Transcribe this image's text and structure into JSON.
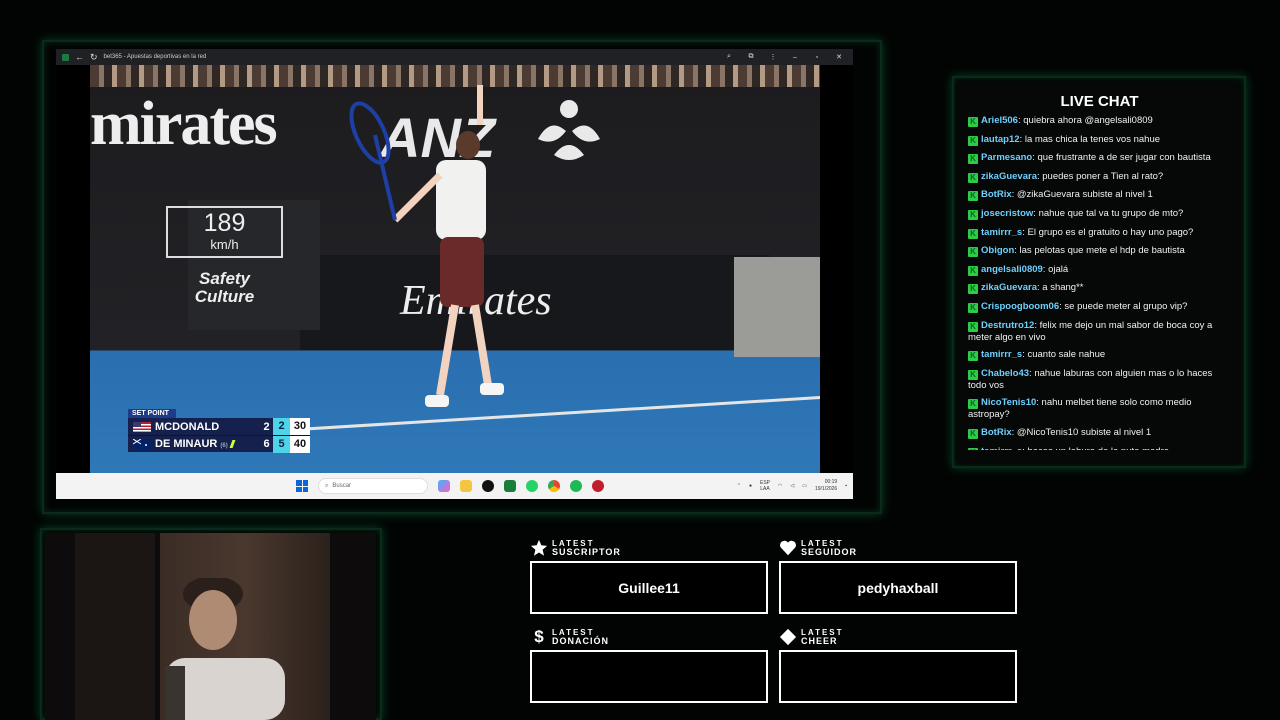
{
  "browser": {
    "tab_title": "bet365 - Apuestas deportivas en la red"
  },
  "video": {
    "speed": {
      "value": "189",
      "unit": "km/h"
    },
    "sponsors": {
      "emirates_big": "mirates",
      "anz": "ANZ",
      "safety": "Safety Culture",
      "emirates_small": "Emirates"
    },
    "scoreboard": {
      "tag": "SET POINT",
      "players": [
        {
          "name": "MCDONALD",
          "seed": "",
          "sets": "2",
          "games": "2",
          "points": "30"
        },
        {
          "name": "DE MINAUR",
          "seed": "(6)",
          "sets": "6",
          "games": "5",
          "points": "40"
        }
      ]
    }
  },
  "taskbar": {
    "search_placeholder": "Buscar",
    "lang": "ESP\nLAA",
    "time": "00:19",
    "date": "19/1/2026"
  },
  "chat": {
    "title": "LIVE CHAT",
    "messages": [
      {
        "user": "Ariel506",
        "text": "quiebra ahora @angelsali0809"
      },
      {
        "user": "lautap12",
        "text": "la mas chica la tenes vos nahue"
      },
      {
        "user": "Parmesano",
        "text": "que frustrante a de ser jugar con bautista"
      },
      {
        "user": "zikaGuevara",
        "text": "puedes poner a Tien al rato?"
      },
      {
        "user": "BotRix",
        "text": "@zikaGuevara subiste al nivel 1"
      },
      {
        "user": "josecristow",
        "text": "nahue que tal va tu grupo de mto?"
      },
      {
        "user": "tamirrr_s",
        "text": "El grupo es el gratuito o hay uno pago?"
      },
      {
        "user": "Obigon",
        "text": "las pelotas que mete el hdp de bautista"
      },
      {
        "user": "angelsali0809",
        "text": "ojalá"
      },
      {
        "user": "zikaGuevara",
        "text": "a shang**"
      },
      {
        "user": "Crispoogboom06",
        "text": "se puede meter al grupo vip?"
      },
      {
        "user": "Destrutro12",
        "text": "felix me dejo un mal sabor de boca coy a meter algo en vivo"
      },
      {
        "user": "tamirrr_s",
        "text": "cuanto sale nahue"
      },
      {
        "user": "Chabelo43",
        "text": "nahue laburas con alguien mas o lo haces todo vos"
      },
      {
        "user": "NicoTenis10",
        "text": "nahu melbet tiene solo como medio astropay?"
      },
      {
        "user": "BotRix",
        "text": "@NicoTenis10 subiste al nivel 1"
      },
      {
        "user": "tamirrr_s",
        "text": "haces un laburo de la puta madre"
      }
    ]
  },
  "widgets": {
    "suscriptor": {
      "small": "LATEST",
      "label": "SUSCRIPTOR",
      "value": "Guillee11"
    },
    "seguidor": {
      "small": "LATEST",
      "label": "SEGUIDOR",
      "value": "pedyhaxball"
    },
    "donacion": {
      "small": "LATEST",
      "label": "DONACIÓN",
      "value": ""
    },
    "cheer": {
      "small": "LATEST",
      "label": "CHEER",
      "value": ""
    }
  },
  "colors": {
    "accent": "#14ff8c",
    "chat_user": "#6fd0ff",
    "badge": "#2ecc40",
    "score_cyan": "#4dd4e8"
  }
}
